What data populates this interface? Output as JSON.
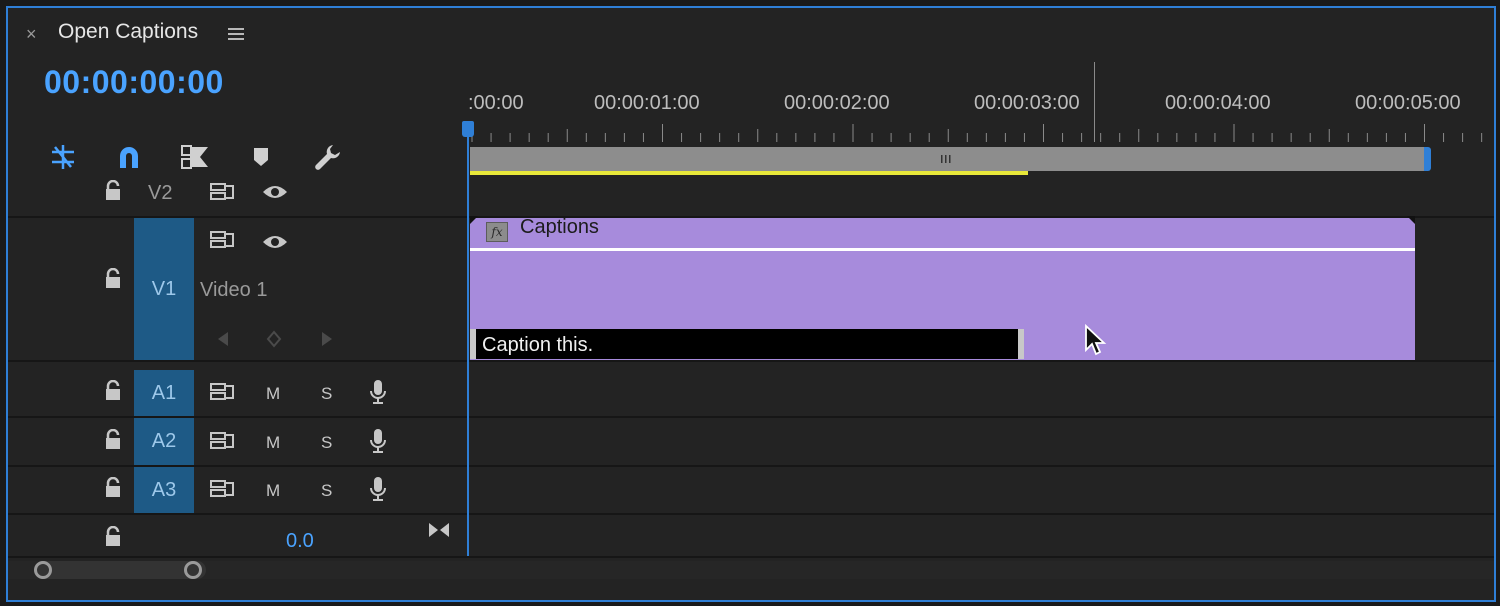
{
  "panel": {
    "close_glyph": "×",
    "title": "Open Captions",
    "menu_glyph": "≡",
    "timecode": "00:00:00:00"
  },
  "toolbar": {
    "icons": [
      "insert-nest-icon",
      "snap-magnet-icon",
      "linked-selection-icon",
      "add-marker-icon",
      "settings-wrench-icon"
    ]
  },
  "ruler": {
    "labels": [
      ":00:00",
      "00:00:01:00",
      "00:00:02:00",
      "00:00:03:00",
      "00:00:04:00",
      "00:00:05:00"
    ]
  },
  "tracks": {
    "v2": {
      "label": "V2"
    },
    "v1": {
      "label": "V1",
      "name": "Video 1"
    },
    "a1": {
      "label": "A1",
      "mute": "M",
      "solo": "S"
    },
    "a2": {
      "label": "A2",
      "mute": "M",
      "solo": "S"
    },
    "a3": {
      "label": "A3",
      "mute": "M",
      "solo": "S"
    },
    "master": {
      "volume": "0.0"
    }
  },
  "clips": {
    "captions_clip": {
      "title": "Captions",
      "fx": "fx"
    },
    "caption_item": {
      "text": "Caption this."
    }
  },
  "colors": {
    "accent": "#2f7fd6",
    "timecode": "#4aa3ff",
    "clip": "#a78bdc",
    "render_bar": "#e8e83a",
    "track_target": "#1e5a86"
  }
}
